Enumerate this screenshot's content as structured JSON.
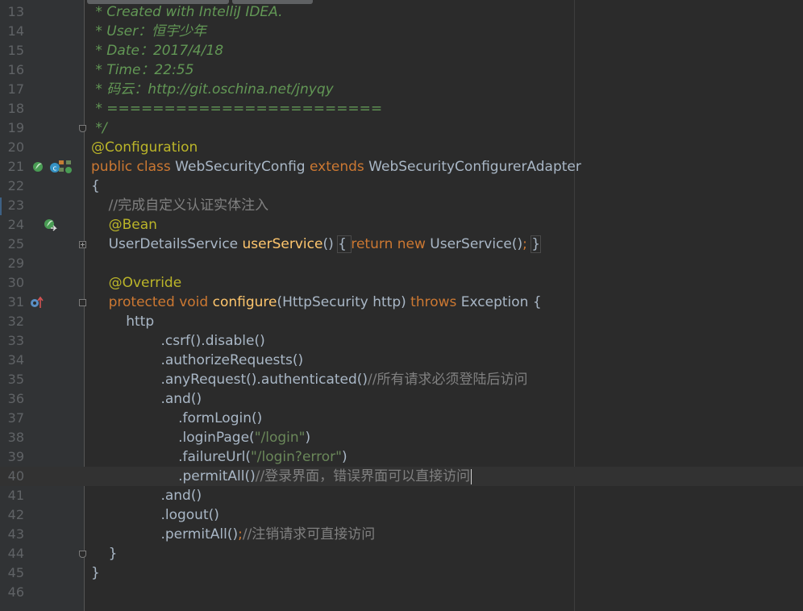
{
  "editor": {
    "lines": [
      {
        "n": "13",
        "segments": [
          {
            "t": " * Created with IntelliJ IDEA.",
            "c": "comment"
          }
        ]
      },
      {
        "n": "14",
        "segments": [
          {
            "t": " * User：恒宇少年",
            "c": "comment"
          }
        ]
      },
      {
        "n": "15",
        "segments": [
          {
            "t": " * Date：2017/4/18",
            "c": "comment"
          }
        ]
      },
      {
        "n": "16",
        "segments": [
          {
            "t": " * Time：22:55",
            "c": "comment"
          }
        ]
      },
      {
        "n": "17",
        "segments": [
          {
            "t": " * 码云：http://git.oschina.net/jnyqy",
            "c": "comment"
          }
        ]
      },
      {
        "n": "18",
        "segments": [
          {
            "t": " * ========================",
            "c": "comment"
          }
        ]
      },
      {
        "n": "19",
        "segments": [
          {
            "t": " */",
            "c": "comment"
          }
        ]
      },
      {
        "n": "20",
        "segments": [
          {
            "t": "@Configuration",
            "c": "annot"
          }
        ]
      },
      {
        "n": "21",
        "segments": [
          {
            "t": "public class ",
            "c": "kw"
          },
          {
            "t": "WebSecurityConfig ",
            "c": "plain"
          },
          {
            "t": "extends ",
            "c": "kw"
          },
          {
            "t": "WebSecurityConfigurerAdapter",
            "c": "plain"
          }
        ]
      },
      {
        "n": "22",
        "segments": [
          {
            "t": "{",
            "c": "plain"
          }
        ]
      },
      {
        "n": "23",
        "segments": [
          {
            "t": "    //完成自定义认证实体注入",
            "c": "line-comment"
          }
        ]
      },
      {
        "n": "24",
        "segments": [
          {
            "t": "    @Bean",
            "c": "annot"
          }
        ]
      },
      {
        "n": "25",
        "segments": [
          {
            "t": "    UserDetailsService ",
            "c": "plain"
          },
          {
            "t": "userService",
            "c": "method"
          },
          {
            "t": "() ",
            "c": "plain"
          },
          {
            "t": "{ ",
            "c": "plain",
            "box": true
          },
          {
            "t": "return new ",
            "c": "kw"
          },
          {
            "t": "UserService()",
            "c": "plain"
          },
          {
            "t": "; ",
            "c": "kw"
          },
          {
            "t": "}",
            "c": "plain",
            "box": true
          }
        ]
      },
      {
        "n": "29",
        "segments": []
      },
      {
        "n": "30",
        "segments": [
          {
            "t": "    @Override",
            "c": "annot"
          }
        ]
      },
      {
        "n": "31",
        "segments": [
          {
            "t": "    protected void ",
            "c": "kw"
          },
          {
            "t": "configure",
            "c": "method"
          },
          {
            "t": "(HttpSecurity http) ",
            "c": "plain"
          },
          {
            "t": "throws ",
            "c": "kw"
          },
          {
            "t": "Exception {",
            "c": "plain"
          }
        ]
      },
      {
        "n": "32",
        "segments": [
          {
            "t": "        http",
            "c": "plain"
          }
        ]
      },
      {
        "n": "33",
        "segments": [
          {
            "t": "                .csrf().disable()",
            "c": "plain"
          }
        ]
      },
      {
        "n": "34",
        "segments": [
          {
            "t": "                .authorizeRequests()",
            "c": "plain"
          }
        ]
      },
      {
        "n": "35",
        "segments": [
          {
            "t": "                .anyRequest().authenticated()",
            "c": "plain"
          },
          {
            "t": "//所有请求必须登陆后访问",
            "c": "line-comment"
          }
        ]
      },
      {
        "n": "36",
        "segments": [
          {
            "t": "                .and()",
            "c": "plain"
          }
        ]
      },
      {
        "n": "37",
        "segments": [
          {
            "t": "                    .formLogin()",
            "c": "plain"
          }
        ]
      },
      {
        "n": "38",
        "segments": [
          {
            "t": "                    .loginPage(",
            "c": "plain"
          },
          {
            "t": "\"/login\"",
            "c": "str"
          },
          {
            "t": ")",
            "c": "plain"
          }
        ]
      },
      {
        "n": "39",
        "segments": [
          {
            "t": "                    .failureUrl(",
            "c": "plain"
          },
          {
            "t": "\"/login?error\"",
            "c": "str"
          },
          {
            "t": ")",
            "c": "plain"
          }
        ]
      },
      {
        "n": "40",
        "segments": [
          {
            "t": "                    .permitAll()",
            "c": "plain"
          },
          {
            "t": "//登录界面，错误界面可以直接访问",
            "c": "line-comment"
          }
        ]
      },
      {
        "n": "41",
        "segments": [
          {
            "t": "                .and()",
            "c": "plain"
          }
        ]
      },
      {
        "n": "42",
        "segments": [
          {
            "t": "                .logout()",
            "c": "plain"
          }
        ]
      },
      {
        "n": "43",
        "segments": [
          {
            "t": "                .permitAll()",
            "c": "plain"
          },
          {
            "t": ";",
            "c": "kw"
          },
          {
            "t": "//注销请求可直接访问",
            "c": "line-comment"
          }
        ]
      },
      {
        "n": "44",
        "segments": [
          {
            "t": "    }",
            "c": "plain"
          }
        ]
      },
      {
        "n": "45",
        "segments": [
          {
            "t": "}",
            "c": "plain"
          }
        ]
      },
      {
        "n": "46",
        "segments": []
      }
    ],
    "caret_line": "40",
    "colors": {
      "background": "#2b2b2b",
      "gutter": "#313335",
      "line_number": "#606366",
      "keyword": "#cc7832",
      "annotation": "#bbb529",
      "method": "#ffc66d",
      "string": "#6a8759",
      "doc_comment": "#629755",
      "line_comment": "#808080",
      "text": "#a9b7c6"
    },
    "gutter_icons": [
      {
        "line": "21",
        "icons": [
          "spring-bean-icon",
          "class-icon",
          "spring-config-icon"
        ]
      },
      {
        "line": "24",
        "icons": [
          "spring-bean-navigate-icon"
        ]
      },
      {
        "line": "31",
        "icons": [
          "override-method-icon"
        ]
      }
    ]
  }
}
